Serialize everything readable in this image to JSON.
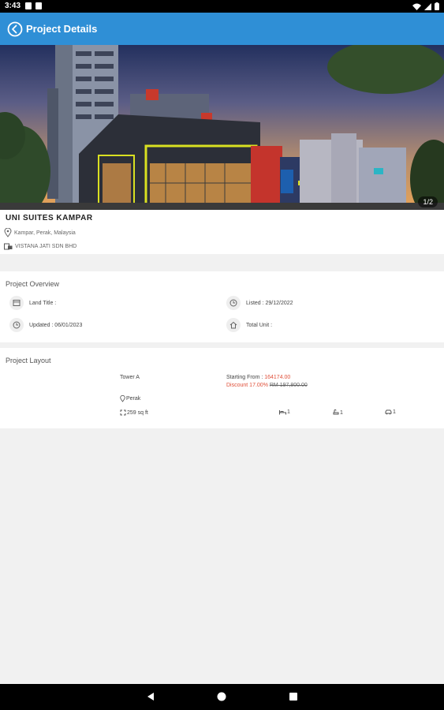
{
  "status_bar": {
    "time": "3:43"
  },
  "app_bar": {
    "title": "Project Details"
  },
  "gallery": {
    "counter": "1/2"
  },
  "project": {
    "name": "UNI SUITES KAMPAR",
    "location": "Kampar, Perak, Malaysia",
    "developer": "VISTANA JATI SDN BHD"
  },
  "overview": {
    "title": "Project Overview",
    "land_title": "Land Title :",
    "listed": "Listed : 29/12/2022",
    "updated": "Updated : 06/01/2023",
    "total_unit": "Total Unit :"
  },
  "layout": {
    "title": "Project Layout",
    "tower": "Tower A",
    "starting_from_label": "Starting From : ",
    "starting_price": "164174.00",
    "discount_label": "Discount 17.00% ",
    "original_price": "RM 197,800.00",
    "state": "Perak",
    "size": "259 sq ft",
    "bedrooms": "1",
    "bathrooms": "1",
    "carparks": "1"
  },
  "icons": [
    "back-arrow-icon",
    "location-pin-icon",
    "developer-icon",
    "calendar-icon",
    "clock-icon",
    "home-icon",
    "wifi-icon",
    "battery-icon",
    "nav-back-icon",
    "nav-home-icon",
    "nav-recents-icon"
  ]
}
